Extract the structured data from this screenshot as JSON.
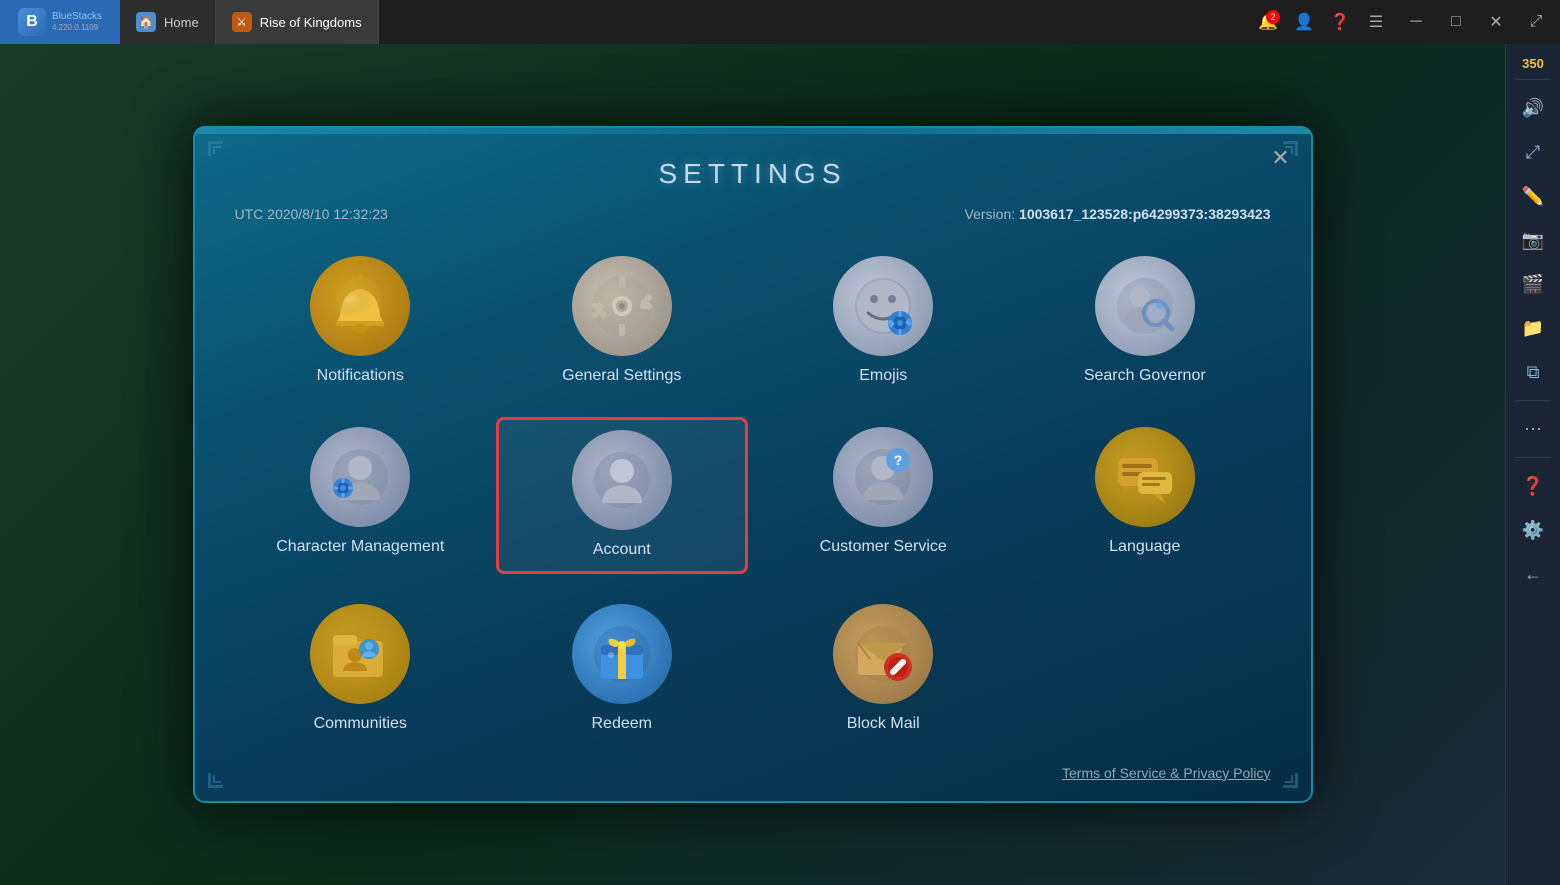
{
  "taskbar": {
    "app_name": "BlueStacks",
    "app_version": "4.220.0.1109",
    "home_tab": "Home",
    "game_tab": "Rise of Kingdoms",
    "notification_count": "2",
    "coins": "350"
  },
  "dialog": {
    "title": "SETTINGS",
    "close_label": "✕",
    "timestamp": "UTC 2020/8/10 12:32:23",
    "version_label": "Version:",
    "version_value": "1003617_123528:p64299373:38293423",
    "terms_label": "Terms of Service & Privacy Policy",
    "items": [
      {
        "id": "notifications",
        "label": "Notifications",
        "icon": "🔔",
        "icon_type": "bell",
        "selected": false
      },
      {
        "id": "general-settings",
        "label": "General Settings",
        "icon": "⚙️",
        "icon_type": "gear",
        "selected": false
      },
      {
        "id": "emojis",
        "label": "Emojis",
        "icon": "😊",
        "icon_type": "emoji",
        "selected": false
      },
      {
        "id": "search-governor",
        "label": "Search Governor",
        "icon": "🔍",
        "icon_type": "search",
        "selected": false
      },
      {
        "id": "character-management",
        "label": "Character Management",
        "icon": "👤",
        "icon_type": "character",
        "selected": false
      },
      {
        "id": "account",
        "label": "Account",
        "icon": "👤",
        "icon_type": "account",
        "selected": true
      },
      {
        "id": "customer-service",
        "label": "Customer Service",
        "icon": "👤",
        "icon_type": "customer",
        "selected": false
      },
      {
        "id": "language",
        "label": "Language",
        "icon": "💬",
        "icon_type": "language",
        "selected": false
      },
      {
        "id": "communities",
        "label": "Communities",
        "icon": "📁",
        "icon_type": "communities",
        "selected": false
      },
      {
        "id": "redeem",
        "label": "Redeem",
        "icon": "🎁",
        "icon_type": "redeem",
        "selected": false
      },
      {
        "id": "block-mail",
        "label": "Block Mail",
        "icon": "✉️",
        "icon_type": "blockmail",
        "selected": false
      }
    ]
  },
  "sidebar": {
    "icons": [
      {
        "id": "avatar",
        "symbol": "🧑"
      },
      {
        "id": "volume",
        "symbol": "🔊"
      },
      {
        "id": "expand",
        "symbol": "⤢"
      },
      {
        "id": "draw",
        "symbol": "✏️"
      },
      {
        "id": "screenshot",
        "symbol": "📷"
      },
      {
        "id": "video",
        "symbol": "🎬"
      },
      {
        "id": "folder",
        "symbol": "📁"
      },
      {
        "id": "copy",
        "symbol": "⧉"
      },
      {
        "id": "more",
        "symbol": "⋯"
      },
      {
        "id": "question",
        "symbol": "❓"
      },
      {
        "id": "settings-gear",
        "symbol": "⚙️"
      },
      {
        "id": "back",
        "symbol": "←"
      }
    ]
  }
}
